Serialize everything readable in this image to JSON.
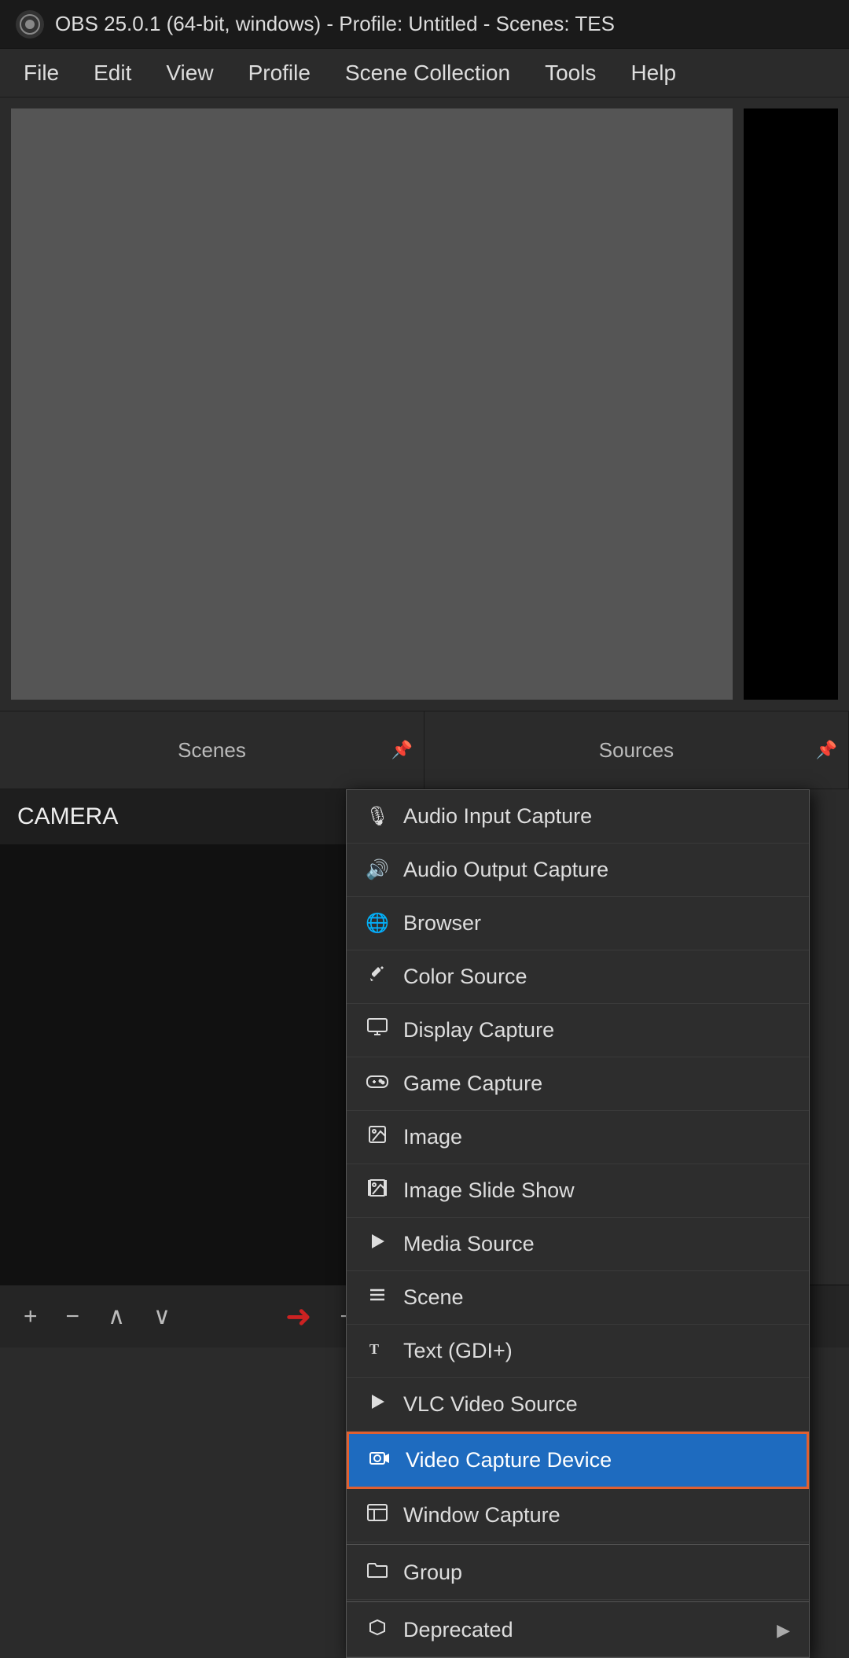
{
  "titleBar": {
    "title": "OBS 25.0.1 (64-bit, windows) - Profile: Untitled - Scenes: TES"
  },
  "menuBar": {
    "items": [
      "File",
      "Edit",
      "View",
      "Profile",
      "Scene Collection",
      "Tools",
      "Help"
    ]
  },
  "panels": {
    "scenes": "Scenes",
    "sources": "Sources"
  },
  "scenesList": {
    "items": [
      "CAMERA"
    ]
  },
  "contextMenu": {
    "items": [
      {
        "id": "audio-input-capture",
        "label": "Audio Input Capture",
        "icon": "mic"
      },
      {
        "id": "audio-output-capture",
        "label": "Audio Output Capture",
        "icon": "speaker"
      },
      {
        "id": "browser",
        "label": "Browser",
        "icon": "globe"
      },
      {
        "id": "color-source",
        "label": "Color Source",
        "icon": "paint"
      },
      {
        "id": "display-capture",
        "label": "Display Capture",
        "icon": "monitor"
      },
      {
        "id": "game-capture",
        "label": "Game Capture",
        "icon": "gamepad"
      },
      {
        "id": "image",
        "label": "Image",
        "icon": "image"
      },
      {
        "id": "image-slide-show",
        "label": "Image Slide Show",
        "icon": "slideshow"
      },
      {
        "id": "media-source",
        "label": "Media Source",
        "icon": "play"
      },
      {
        "id": "scene",
        "label": "Scene",
        "icon": "list"
      },
      {
        "id": "text-gdi",
        "label": "Text (GDI+)",
        "icon": "text"
      },
      {
        "id": "vlc-video-source",
        "label": "VLC Video Source",
        "icon": "play2"
      },
      {
        "id": "video-capture-device",
        "label": "Video Capture Device",
        "icon": "camera",
        "highlighted": true
      },
      {
        "id": "window-capture",
        "label": "Window Capture",
        "icon": "window"
      },
      {
        "id": "group",
        "label": "Group",
        "icon": "folder"
      },
      {
        "id": "deprecated",
        "label": "Deprecated",
        "icon": "deprecated",
        "hasArrow": true
      }
    ]
  },
  "toolbar": {
    "addLabel": "+",
    "removeLabel": "−",
    "upLabel": "∧",
    "downLabel": "∨"
  },
  "colors": {
    "highlight": "#1e6bbf",
    "highlightBorder": "#e06030",
    "arrowRed": "#cc2222"
  }
}
